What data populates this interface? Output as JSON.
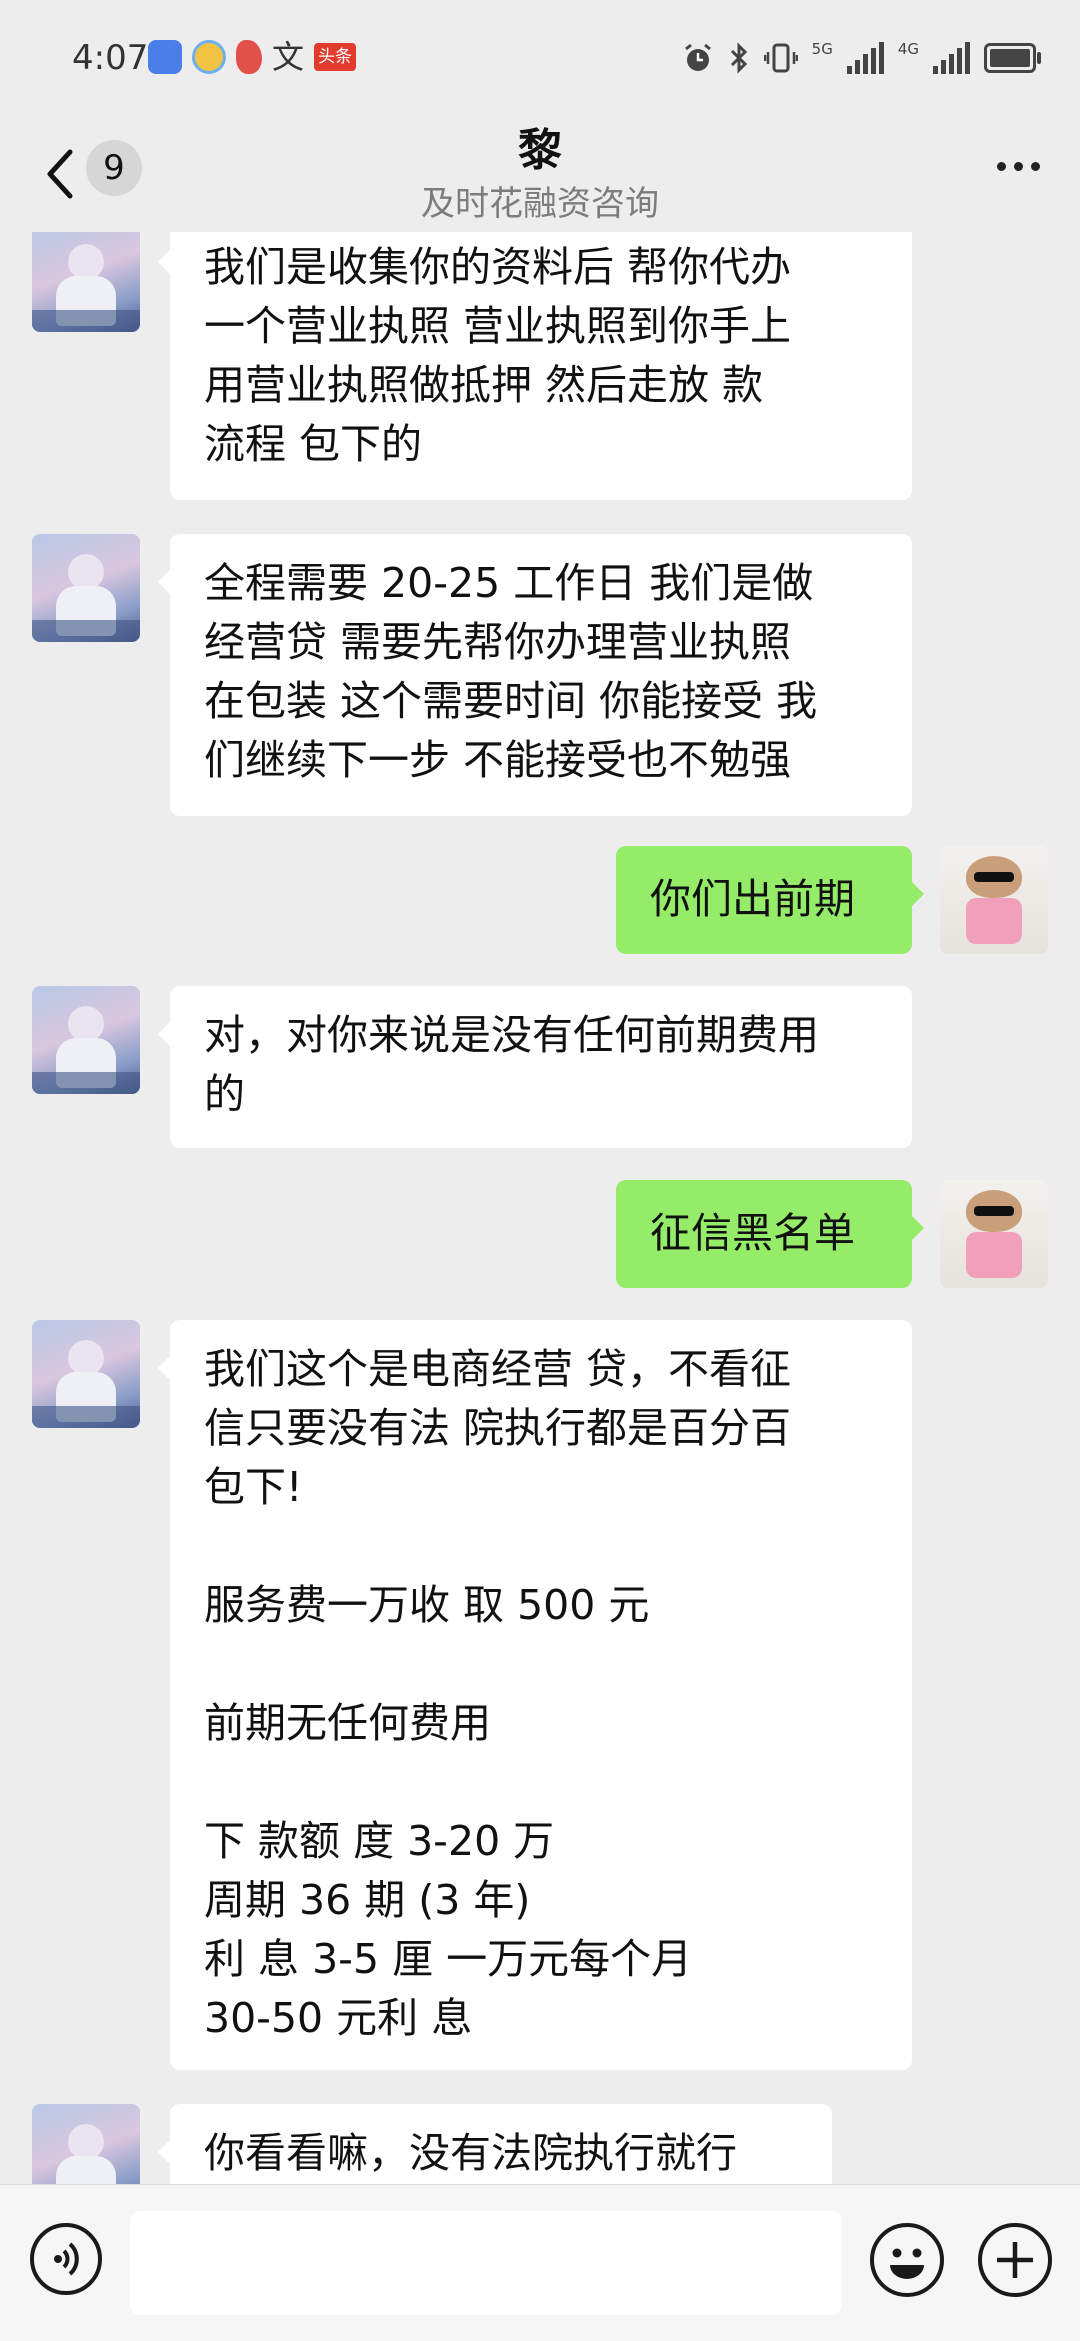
{
  "status_bar": {
    "time": "4:07",
    "notification_icons": [
      "app-blue-icon",
      "app-yellow-icon",
      "app-red-icon",
      "wen-icon",
      "toutiao-icon"
    ],
    "wen_glyph": "文",
    "toutiao_label": "头条",
    "network_1": "5G",
    "network_2": "4G",
    "icons": [
      "alarm-icon",
      "bluetooth-icon",
      "vibrate-icon",
      "signal-icon",
      "battery-icon"
    ]
  },
  "header": {
    "title": "黎",
    "subtitle": "及时花融资咨询",
    "unread_count": "9"
  },
  "messages": [
    {
      "from": "other",
      "text": "我们是收集你的资料后  帮你代办\n一个营业执照  营业执照到你手上\n用营业执照做抵押    然后走放 款\n流程  包下的"
    },
    {
      "from": "other",
      "text": "全程需要 20-25 工作日 我们是做\n经营贷 需要先帮你办理营业执照\n在包装 这个需要时间 你能接受 我\n们继续下一步 不能接受也不勉强"
    },
    {
      "from": "self",
      "text": "你们出前期"
    },
    {
      "from": "other",
      "text": "对，对你来说是没有任何前期费用\n的"
    },
    {
      "from": "self",
      "text": "征信黑名单"
    },
    {
      "from": "other",
      "text": "我们这个是电商经营 贷，不看征\n信只要没有法 院执行都是百分百\n包下!\n\n服务费一万收 取 500 元\n\n前期无任何费用\n\n下 款额 度 3-20 万\n周期 36 期 (3 年)\n利 息 3-5 厘 一万元每个月\n30-50 元利 息"
    },
    {
      "from": "other",
      "text": "你看看嘛，没有法院执行就行"
    }
  ],
  "input_bar": {
    "placeholder": "",
    "icons": [
      "voice-icon",
      "emoji-icon",
      "plus-icon"
    ]
  },
  "colors": {
    "background": "#ededed",
    "incoming_bubble": "#ffffff",
    "outgoing_bubble": "#95ec69"
  }
}
